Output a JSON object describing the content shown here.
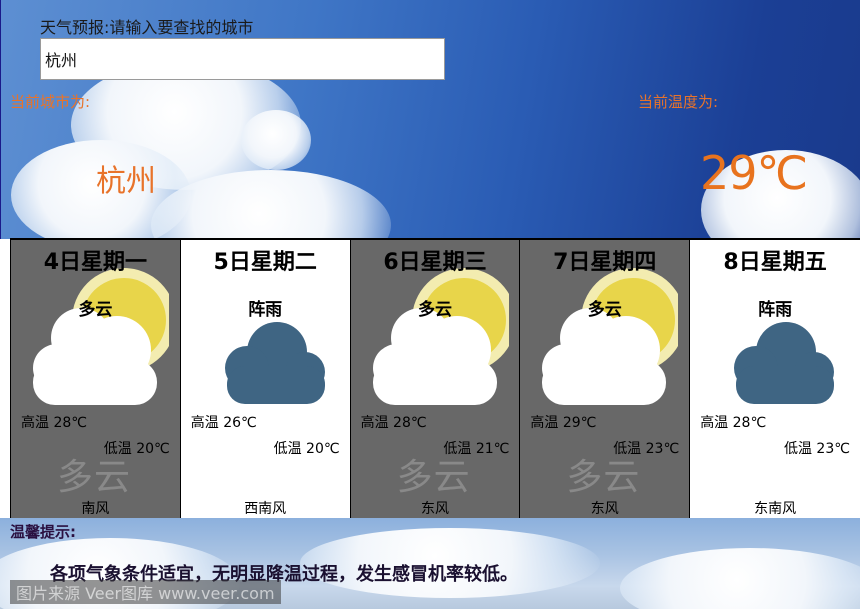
{
  "header": {
    "prompt": "天气预报:请输入要查找的城市",
    "input_value": "杭州"
  },
  "current": {
    "city_label": "当前城市为:",
    "city": "杭州",
    "temp_label": "当前温度为:",
    "temp": "29℃"
  },
  "forecast": [
    {
      "date": "4日星期一",
      "condition": "多云",
      "icon": "partly-cloudy-icon",
      "high": "高温 28℃",
      "low": "低温 20℃",
      "wind": "南风",
      "watermark": "多云",
      "bg": "gray"
    },
    {
      "date": "5日星期二",
      "condition": "阵雨",
      "icon": "rain-cloud-icon",
      "high": "高温 26℃",
      "low": "低温 20℃",
      "wind": "西南风",
      "watermark": "",
      "bg": "white"
    },
    {
      "date": "6日星期三",
      "condition": "多云",
      "icon": "partly-cloudy-icon",
      "high": "高温 28℃",
      "low": "低温 21℃",
      "wind": "东风",
      "watermark": "多云",
      "bg": "gray"
    },
    {
      "date": "7日星期四",
      "condition": "多云",
      "icon": "partly-cloudy-icon",
      "high": "高温 29℃",
      "low": "低温 23℃",
      "wind": "东风",
      "watermark": "多云",
      "bg": "gray"
    },
    {
      "date": "8日星期五",
      "condition": "阵雨",
      "icon": "rain-cloud-icon",
      "high": "高温 28℃",
      "low": "低温 23℃",
      "wind": "东南风",
      "watermark": "",
      "bg": "white"
    }
  ],
  "tips": {
    "title": "温馨提示:",
    "text": "各项气象条件适宜，无明显降温过程，发生感冒机率较低。",
    "photo_credit": "图片来源 Veer图库 www.veer.com"
  },
  "colors": {
    "accent": "#e8732a",
    "card_gray": "#686868",
    "rain_cloud": "#3f6583",
    "sun": "#e8d54a"
  }
}
